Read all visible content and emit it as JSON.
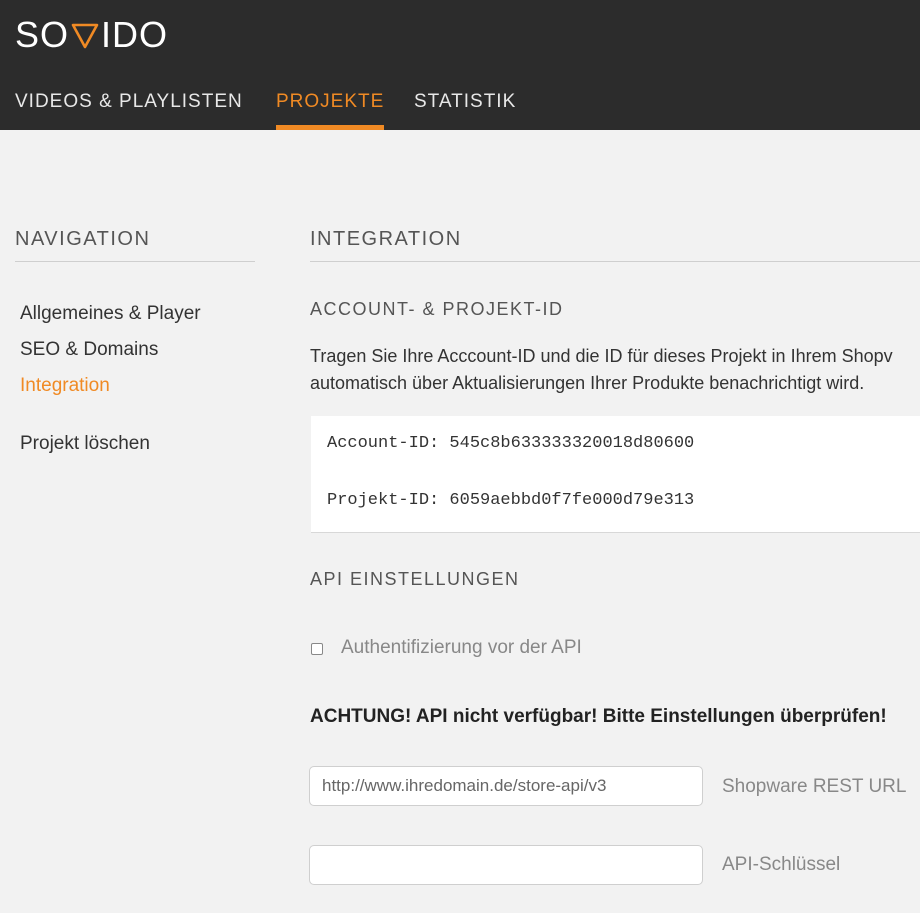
{
  "brand": {
    "name_left": "SO",
    "name_right": "IDO",
    "accent": "#f08a24"
  },
  "tabs": [
    {
      "label": "VIDEOS & PLAYLISTEN"
    },
    {
      "label": "PROJEKTE"
    },
    {
      "label": "STATISTIK"
    }
  ],
  "sidebar": {
    "title": "NAVIGATION",
    "items": [
      {
        "label": "Allgemeines & Player"
      },
      {
        "label": "SEO & Domains"
      },
      {
        "label": "Integration"
      },
      {
        "label": "Projekt löschen"
      }
    ]
  },
  "main": {
    "title": "INTEGRATION",
    "account_section": {
      "title": "ACCOUNT- & PROJEKT-ID",
      "description_line1": "Tragen Sie Ihre Acccount-ID und die ID für dieses Projekt in Ihrem Shopv",
      "description_line2": "automatisch über Aktualisierungen Ihrer Produkte benachrichtigt wird.",
      "account_id_line": "Account-ID: 545c8b633333320018d80600",
      "project_id_line": "Projekt-ID: 6059aebbd0f7fe000d79e313"
    },
    "api_section": {
      "title": "API EINSTELLUNGEN",
      "auth_checkbox_label": "Authentifizierung vor der API",
      "warning": "ACHTUNG! API nicht verfügbar! Bitte Einstellungen überprüfen!",
      "rest_url_placeholder": "http://www.ihredomain.de/store-api/v3",
      "rest_url_label": "Shopware REST URL",
      "api_key_value": "",
      "api_key_label": "API-Schlüssel"
    }
  }
}
